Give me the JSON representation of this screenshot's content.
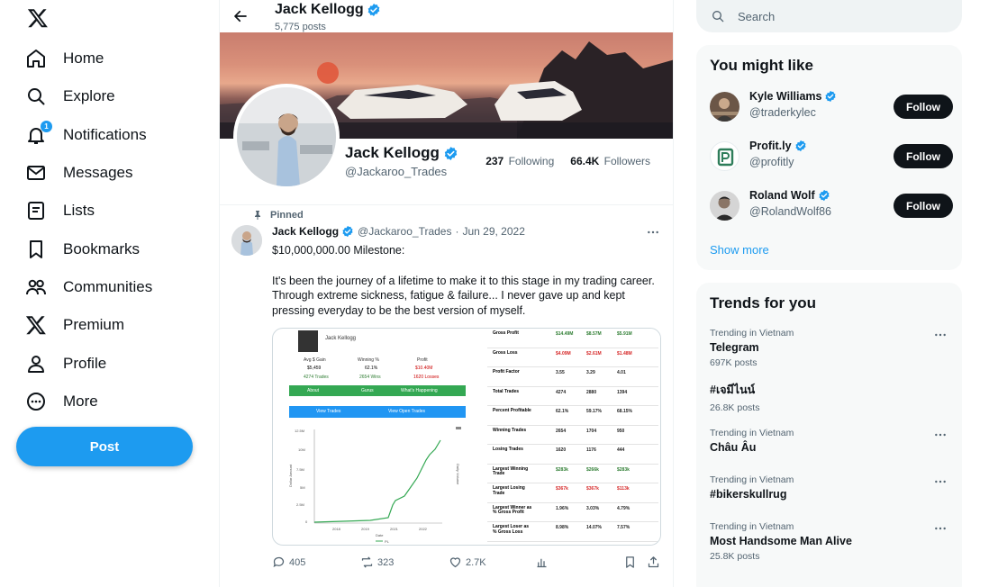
{
  "nav": {
    "items": [
      {
        "label": "Home",
        "icon": "home-icon"
      },
      {
        "label": "Explore",
        "icon": "search-icon"
      },
      {
        "label": "Notifications",
        "icon": "bell-icon",
        "badge": "1"
      },
      {
        "label": "Messages",
        "icon": "envelope-icon"
      },
      {
        "label": "Lists",
        "icon": "list-icon"
      },
      {
        "label": "Bookmarks",
        "icon": "bookmark-icon"
      },
      {
        "label": "Communities",
        "icon": "people-icon"
      },
      {
        "label": "Premium",
        "icon": "x-logo-icon"
      },
      {
        "label": "Profile",
        "icon": "person-icon"
      },
      {
        "label": "More",
        "icon": "more-circle-icon"
      }
    ],
    "post_label": "Post"
  },
  "profile": {
    "name": "Jack Kellogg",
    "post_count": "5,775 posts",
    "handle": "@Jackaroo_Trades",
    "following_count": "237",
    "following_label": "Following",
    "followers_count": "66.4K",
    "followers_label": "Followers"
  },
  "tweet": {
    "pinned_label": "Pinned",
    "name": "Jack Kellogg",
    "handle": "@Jackaroo_Trades",
    "date": "Jun 29, 2022",
    "text1": "$10,000,000.00 Milestone:",
    "text2": "It's been the journey of a lifetime to make it to this stage in my trading career. Through extreme sickness, fatigue & failure... I never gave up and kept pressing everyday to be the best version of myself.",
    "replies": "405",
    "reposts": "323",
    "likes": "2.7K",
    "media": {
      "user": "Jack Kellogg",
      "stat_labels": [
        "Avg $ Gain",
        "Winning %",
        "Profit"
      ],
      "stat_values": [
        "$5,459",
        "62.1%",
        "$10.40M"
      ],
      "stat_subs": [
        "4274 Trades",
        "2654 Wins",
        "1620 Losses"
      ],
      "tabs": [
        "About",
        "Gurus",
        "What's Happening"
      ],
      "buttons": [
        "View Trades",
        "View Open Trades"
      ],
      "chart_yticks": [
        "12.5M",
        "10M",
        "7.5M",
        "5M",
        "2.5M",
        "0"
      ],
      "chart_xticks": [
        "2018",
        "2019",
        "2021",
        "2022"
      ],
      "chart_ylabel": "Dollar Amount",
      "chart_y2label": "Daily Volume",
      "chart_xlabel": "Date",
      "chart_legend": "PL",
      "table": [
        {
          "label": "Gross Profit",
          "v1": "$14.49M",
          "v2": "$8.57M",
          "v3": "$5.91M",
          "color": "green"
        },
        {
          "label": "Gross Loss",
          "v1": "$4.09M",
          "v2": "$2.61M",
          "v3": "$1.48M",
          "color": "red"
        },
        {
          "label": "Profit Factor",
          "v1": "3.55",
          "v2": "3.29",
          "v3": "4.01",
          "color": "black"
        },
        {
          "label": "Total Trades",
          "v1": "4274",
          "v2": "2880",
          "v3": "1394",
          "color": "black"
        },
        {
          "label": "Percent Profitable",
          "v1": "62.1%",
          "v2": "59.17%",
          "v3": "68.15%",
          "color": "black"
        },
        {
          "label": "Winning Trades",
          "v1": "2654",
          "v2": "1704",
          "v3": "950",
          "color": "black"
        },
        {
          "label": "Losing Trades",
          "v1": "1620",
          "v2": "1176",
          "v3": "444",
          "color": "black"
        },
        {
          "label": "Largest Winning Trade",
          "v1": "$283k",
          "v2": "$266k",
          "v3": "$283k",
          "color": "green"
        },
        {
          "label": "Largest Losing Trade",
          "v1": "$367k",
          "v2": "$367k",
          "v3": "$113k",
          "color": "red"
        },
        {
          "label": "Largest Winner as % Gross Profit",
          "v1": "1.96%",
          "v2": "3.03%",
          "v3": "4.79%",
          "color": "black"
        },
        {
          "label": "Largest Loser as % Gross Loss",
          "v1": "8.98%",
          "v2": "14.07%",
          "v3": "7.57%",
          "color": "black"
        }
      ]
    }
  },
  "search": {
    "placeholder": "Search"
  },
  "suggestions": {
    "title": "You might like",
    "users": [
      {
        "name": "Kyle Williams",
        "handle": "@traderkylec",
        "follow": "Follow"
      },
      {
        "name": "Profit.ly",
        "handle": "@profitly",
        "follow": "Follow"
      },
      {
        "name": "Roland Wolf",
        "handle": "@RolandWolf86",
        "follow": "Follow"
      }
    ],
    "show_more": "Show more"
  },
  "trends": {
    "title": "Trends for you",
    "items": [
      {
        "context": "Trending in Vietnam",
        "topic": "Telegram",
        "count": "697K posts"
      },
      {
        "context": "",
        "topic": "#เจมีไนน์",
        "count": "26.8K posts"
      },
      {
        "context": "Trending in Vietnam",
        "topic": "Châu Âu",
        "count": ""
      },
      {
        "context": "Trending in Vietnam",
        "topic": "#bikerskullrug",
        "count": ""
      },
      {
        "context": "Trending in Vietnam",
        "topic": "Most Handsome Man Alive",
        "count": "25.8K posts"
      }
    ]
  },
  "colors": {
    "accent": "#1d9bf0",
    "text": "#0f1419",
    "muted": "#536471",
    "green": "#2ea043",
    "red": "#d62828"
  }
}
